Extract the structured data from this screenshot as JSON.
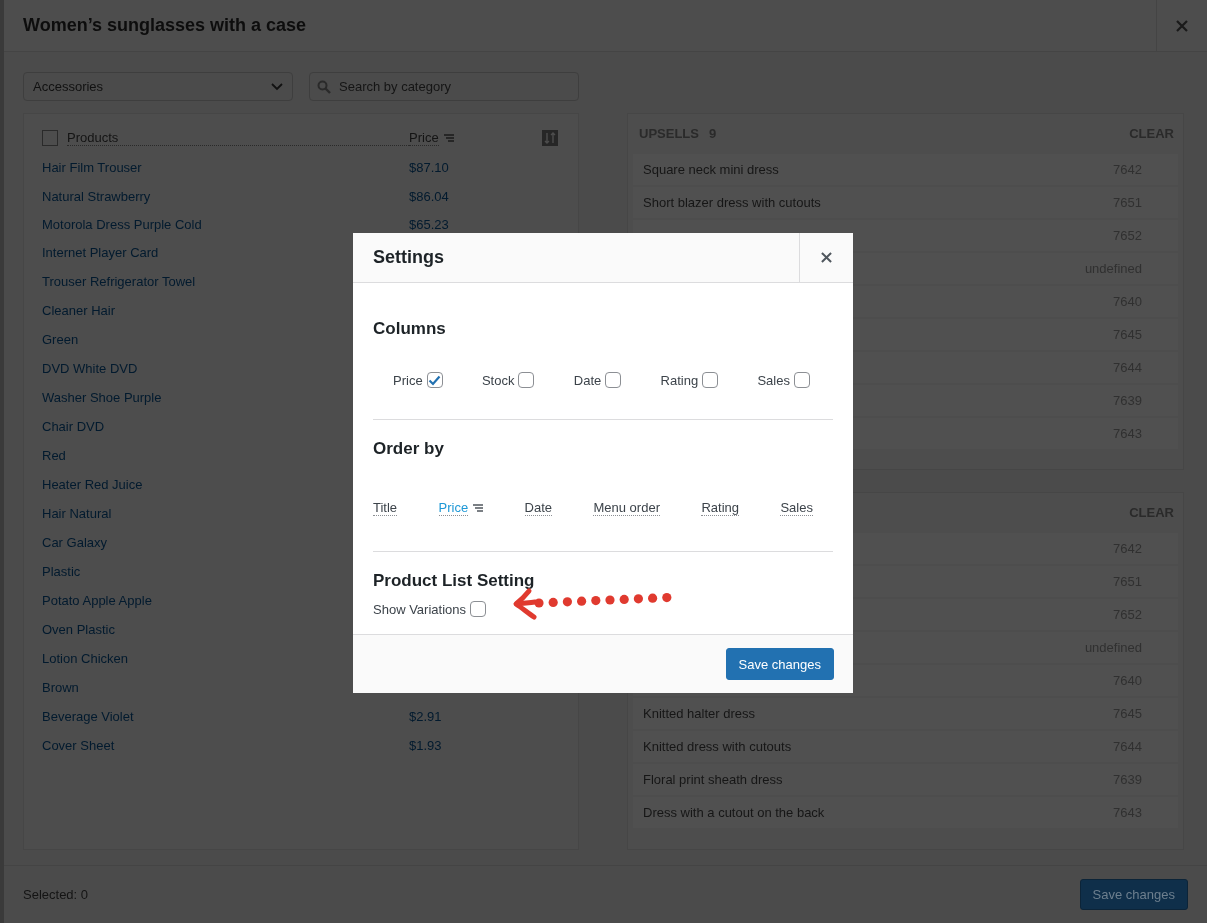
{
  "window": {
    "title": "Women’s sunglasses with a case"
  },
  "category_select": {
    "value": "Accessories"
  },
  "search": {
    "placeholder": "Search by category"
  },
  "products": {
    "select_all_checked": false,
    "columns": [
      "Products",
      "Price"
    ],
    "rows": [
      {
        "name": "Hair Film Trouser",
        "price": "$87.10"
      },
      {
        "name": "Natural Strawberry",
        "price": "$86.04"
      },
      {
        "name": "Motorola Dress Purple Cold",
        "price": "$65.23"
      },
      {
        "name": "Internet Player Card"
      },
      {
        "name": "Trouser Refrigerator Towel"
      },
      {
        "name": "Cleaner Hair"
      },
      {
        "name": "Green"
      },
      {
        "name": "DVD White DVD"
      },
      {
        "name": "Washer Shoe Purple"
      },
      {
        "name": "Chair DVD"
      },
      {
        "name": "Red"
      },
      {
        "name": "Heater Red Juice"
      },
      {
        "name": "Hair Natural"
      },
      {
        "name": "Car Galaxy"
      },
      {
        "name": "Plastic"
      },
      {
        "name": "Potato Apple Apple"
      },
      {
        "name": "Oven Plastic"
      },
      {
        "name": "Lotion Chicken"
      },
      {
        "name": "Brown"
      },
      {
        "name": "Beverage Violet",
        "price": "$2.91"
      },
      {
        "name": "Cover Sheet",
        "price": "$1.93"
      }
    ]
  },
  "upsells": {
    "title": "UPSELLS",
    "count": "9",
    "clear": "CLEAR",
    "items": [
      {
        "name": "Square neck mini dress",
        "id": "7642"
      },
      {
        "name": "Short blazer dress with cutouts",
        "id": "7651"
      },
      {
        "id": "7652"
      },
      {
        "id": "undefined"
      },
      {
        "id": "7640"
      },
      {
        "id": "7645"
      },
      {
        "id": "7644"
      },
      {
        "id": "7639"
      },
      {
        "id": "7643"
      }
    ]
  },
  "list_2": {
    "clear": "CLEAR",
    "items": [
      {
        "id": "7642"
      },
      {
        "id": "7651"
      },
      {
        "id": "7652"
      },
      {
        "id": "undefined"
      },
      {
        "id": "7640"
      },
      {
        "name": "Knitted halter dress",
        "id": "7645"
      },
      {
        "name": "Knitted dress with cutouts",
        "id": "7644"
      },
      {
        "name": "Floral print sheath dress",
        "id": "7639"
      },
      {
        "name": "Dress with a cutout on the back",
        "id": "7643"
      }
    ]
  },
  "footer": {
    "selected": "Selected: 0",
    "save": "Save changes"
  },
  "settings": {
    "title": "Settings",
    "columns_heading": "Columns",
    "columns": [
      {
        "label": "Price",
        "checked": true
      },
      {
        "label": "Stock",
        "checked": false
      },
      {
        "label": "Date",
        "checked": false
      },
      {
        "label": "Rating",
        "checked": false
      },
      {
        "label": "Sales",
        "checked": false
      }
    ],
    "order_heading": "Order by",
    "order_by": [
      {
        "label": "Title",
        "selected": false
      },
      {
        "label": "Price",
        "selected": true
      },
      {
        "label": "Date",
        "selected": false
      },
      {
        "label": "Menu order",
        "selected": false
      },
      {
        "label": "Rating",
        "selected": false
      },
      {
        "label": "Sales",
        "selected": false
      }
    ],
    "list_heading": "Product List Setting",
    "show_variations": {
      "label": "Show Variations",
      "checked": false
    },
    "save": "Save changes"
  }
}
